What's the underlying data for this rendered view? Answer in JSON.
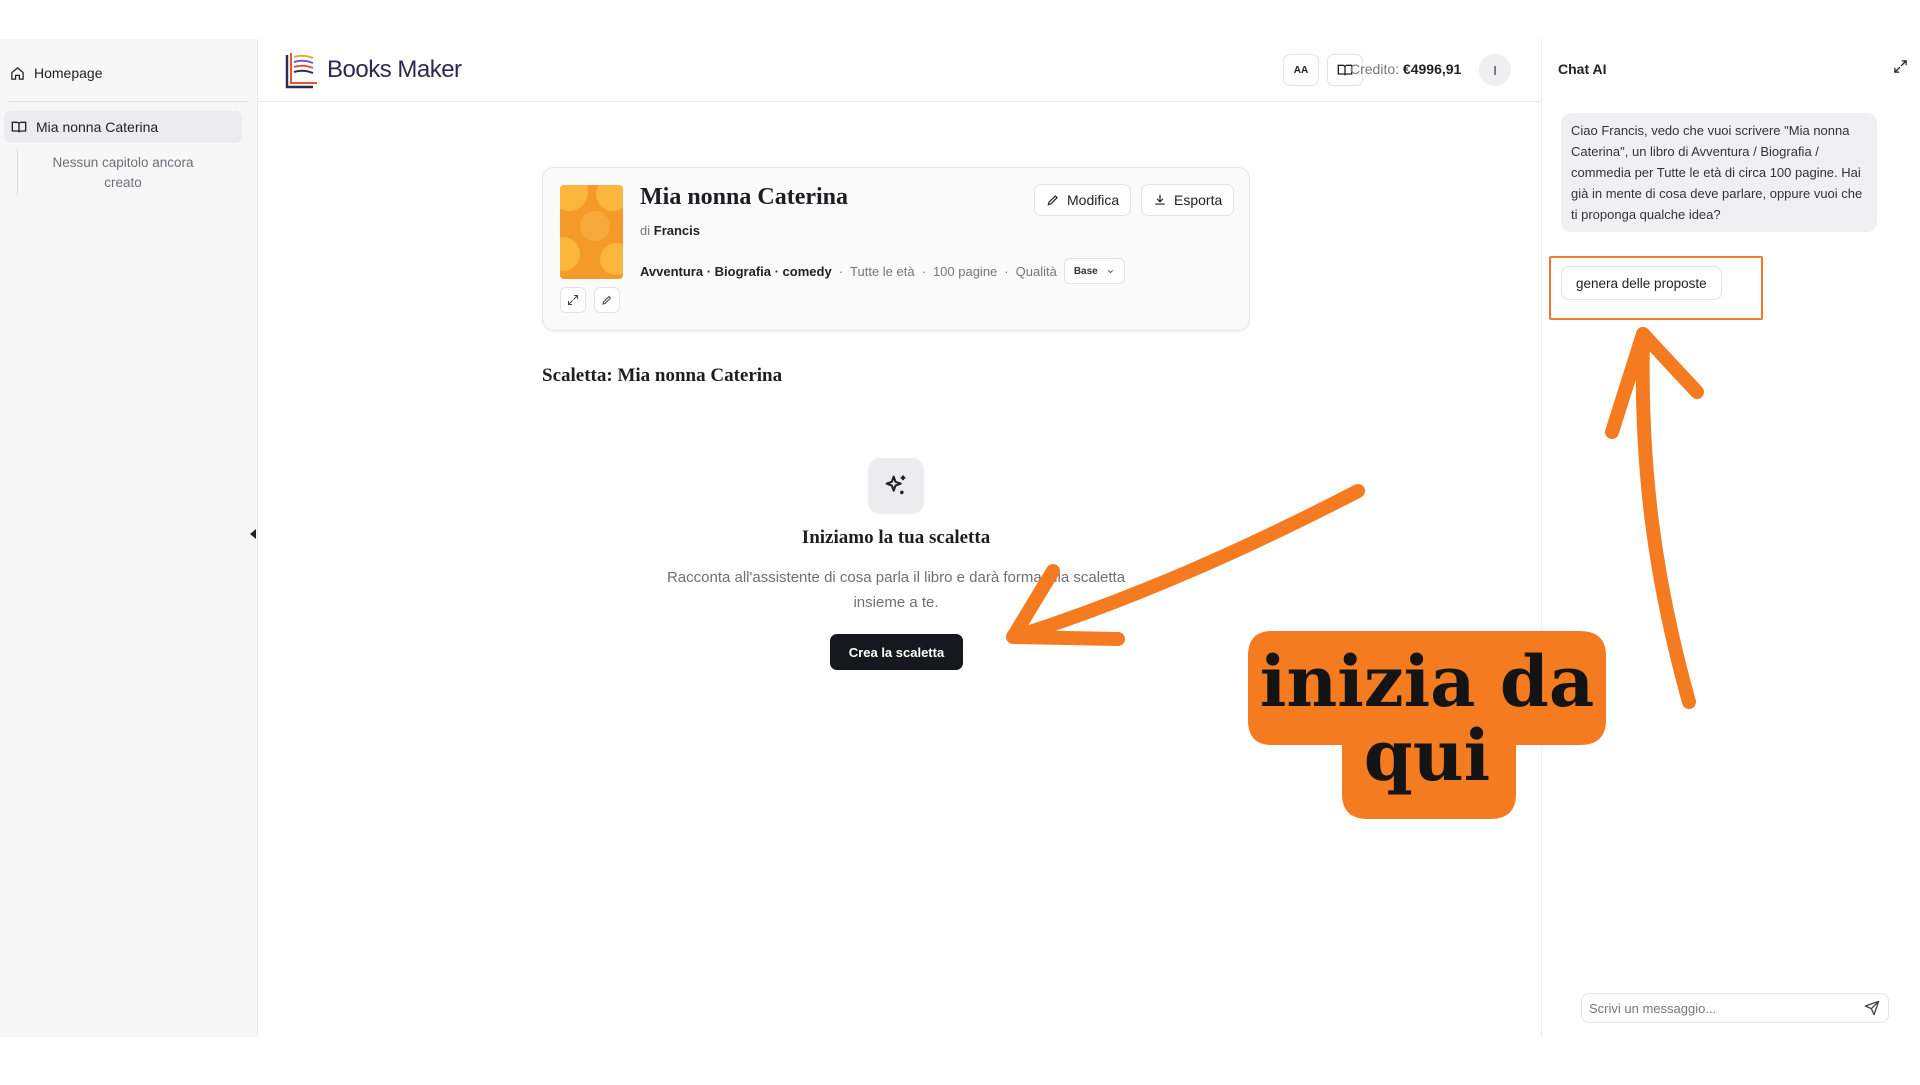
{
  "sidebar": {
    "home_label": "Homepage",
    "book_label": "Mia nonna Caterina",
    "empty_chapters": "Nessun capitolo ancora creato"
  },
  "header": {
    "logo_text": "Books Maker",
    "font_size_button": "AA",
    "credit_label": "Credito:",
    "credit_value": "€4996,91",
    "avatar_initial": "I"
  },
  "book": {
    "title": "Mia nonna Caterina",
    "author_prefix": "di",
    "author": "Francis",
    "genres": "Avventura · Biografia · comedy",
    "audience": "Tutte le età",
    "pages": "100 pagine",
    "quality_label": "Qualità",
    "quality_value": "Base",
    "edit_button": "Modifica",
    "export_button": "Esporta"
  },
  "outline": {
    "title": "Scaletta: Mia nonna Caterina",
    "empty_title": "Iniziamo la tua scaletta",
    "empty_description": "Racconta all'assistente di cosa parla il libro e darà forma alla scaletta insieme a te.",
    "create_button": "Crea la scaletta"
  },
  "chat": {
    "title": "Chat AI",
    "assistant_message": "Ciao Francis, vedo che vuoi scrivere \"Mia nonna Caterina\", un libro di Avventura / Biografia / commedia per Tutte le età di circa 100 pagine. Hai già in mente di cosa deve parlare, oppure vuoi che ti proponga qualche idea?",
    "suggestion_button": "genera delle proposte",
    "input_placeholder": "Scrivi un messaggio..."
  },
  "annotation": {
    "callout_text": "inizia da qui",
    "accent_color": "#f47b20"
  },
  "colors": {
    "primary_button": "#17171f",
    "sidebar_bg": "#f7f7f8",
    "cover": "#f39a28"
  },
  "icons": {
    "home": "home-icon",
    "book": "book-open-icon",
    "edit": "pencil-icon",
    "export": "download-icon",
    "expand": "expand-icon",
    "sparkles": "sparkles-icon",
    "send": "send-icon"
  }
}
